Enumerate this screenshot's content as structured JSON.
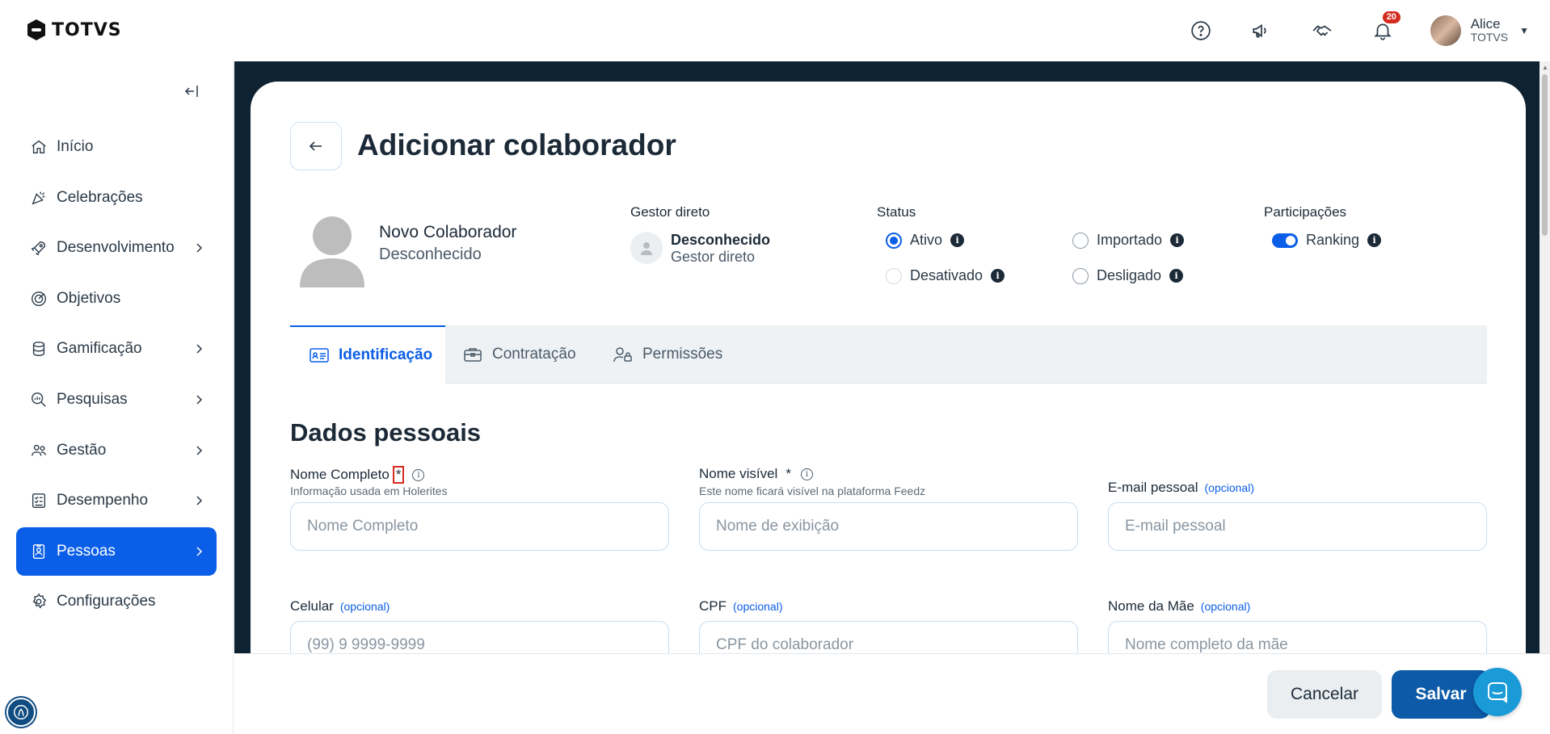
{
  "brand": {
    "name": "TOTVS"
  },
  "topbar": {
    "notifications_count": "20",
    "user": {
      "name": "Alice",
      "org": "TOTVS"
    },
    "icons": [
      "help-icon",
      "megaphone-icon",
      "handshake-icon",
      "bell-icon"
    ]
  },
  "sidebar": {
    "items": [
      {
        "label": "Início",
        "icon": "home-icon",
        "has_children": false,
        "active": false
      },
      {
        "label": "Celebrações",
        "icon": "party-icon",
        "has_children": false,
        "active": false
      },
      {
        "label": "Desenvolvimento",
        "icon": "rocket-icon",
        "has_children": true,
        "active": false
      },
      {
        "label": "Objetivos",
        "icon": "target-icon",
        "has_children": false,
        "active": false
      },
      {
        "label": "Gamificação",
        "icon": "coins-icon",
        "has_children": true,
        "active": false
      },
      {
        "label": "Pesquisas",
        "icon": "search-chart-icon",
        "has_children": true,
        "active": false
      },
      {
        "label": "Gestão",
        "icon": "users-icon",
        "has_children": true,
        "active": false
      },
      {
        "label": "Desempenho",
        "icon": "checklist-icon",
        "has_children": true,
        "active": false
      },
      {
        "label": "Pessoas",
        "icon": "badge-icon",
        "has_children": true,
        "active": true
      },
      {
        "label": "Configurações",
        "icon": "gear-icon",
        "has_children": false,
        "active": false
      }
    ]
  },
  "page": {
    "title": "Adicionar colaborador",
    "profile": {
      "name": "Novo Colaborador",
      "subtitle": "Desconhecido"
    },
    "gestor": {
      "label": "Gestor direto",
      "name": "Desconhecido",
      "subtitle": "Gestor direto"
    },
    "status": {
      "label": "Status",
      "options": [
        {
          "label": "Ativo",
          "checked": true
        },
        {
          "label": "Importado",
          "checked": false
        },
        {
          "label": "Desativado",
          "checked": false
        },
        {
          "label": "Desligado",
          "checked": false
        }
      ]
    },
    "participacoes": {
      "label": "Participações",
      "ranking_label": "Ranking",
      "ranking_on": true
    },
    "tabs": [
      {
        "label": "Identificação",
        "active": true
      },
      {
        "label": "Contratação",
        "active": false
      },
      {
        "label": "Permissões",
        "active": false
      }
    ],
    "section_title": "Dados pessoais",
    "fields": {
      "nome_completo": {
        "label": "Nome Completo",
        "required": "*",
        "help": "Informação usada em Holerites",
        "placeholder": "Nome Completo",
        "value": ""
      },
      "nome_visivel": {
        "label": "Nome visível",
        "required": "*",
        "help": "Este nome ficará visível na plataforma Feedz",
        "placeholder": "Nome de exibição",
        "value": ""
      },
      "email_pessoal": {
        "label": "E-mail pessoal",
        "optional": "(opcional)",
        "placeholder": "E-mail pessoal",
        "value": ""
      },
      "celular": {
        "label": "Celular",
        "optional": "(opcional)",
        "placeholder": "(99) 9 9999-9999",
        "value": ""
      },
      "cpf": {
        "label": "CPF",
        "optional": "(opcional)",
        "placeholder": "CPF do colaborador",
        "value": ""
      },
      "nome_mae": {
        "label": "Nome da Mãe",
        "optional": "(opcional)",
        "placeholder": "Nome completo da mãe",
        "value": ""
      }
    }
  },
  "footer": {
    "cancel_label": "Cancelar",
    "save_label": "Salvar"
  },
  "colors": {
    "accent": "#0a5ee8",
    "frame": "#0f2232",
    "save": "#0d5ba8",
    "required_highlight": "#d52b1e"
  }
}
